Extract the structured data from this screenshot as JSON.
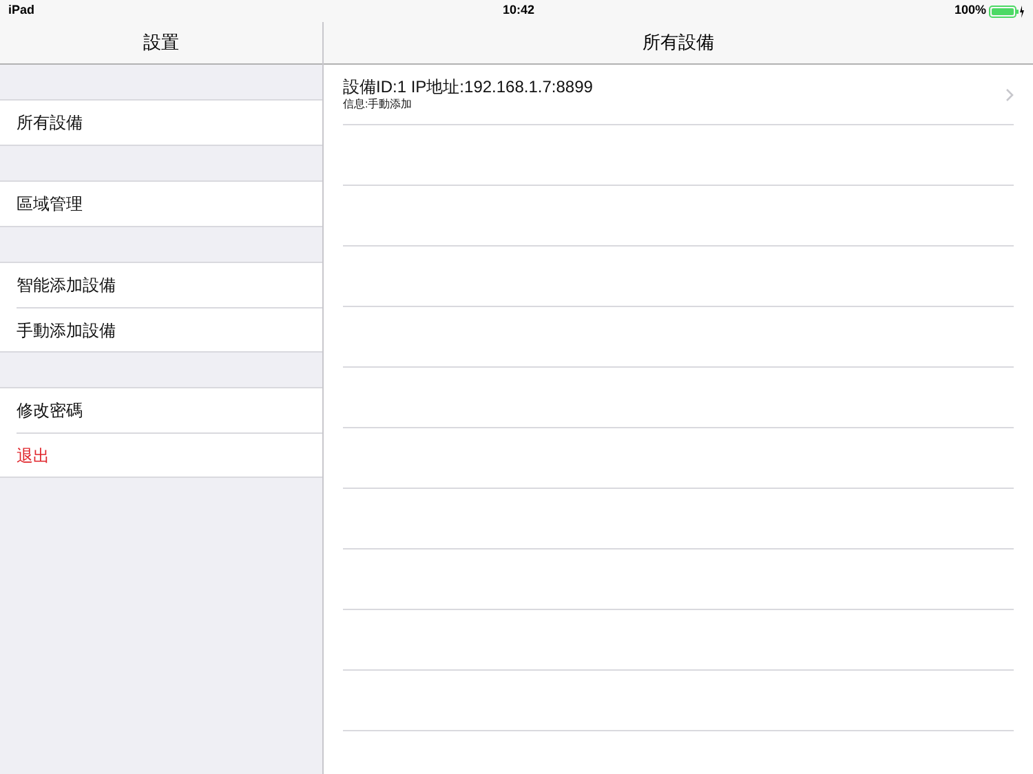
{
  "status_bar": {
    "device": "iPad",
    "time": "10:42",
    "battery": "100%"
  },
  "sidebar": {
    "title": "設置",
    "groups": [
      [
        {
          "label": "所有設備",
          "kind": "normal"
        }
      ],
      [
        {
          "label": "區域管理",
          "kind": "normal"
        }
      ],
      [
        {
          "label": "智能添加設備",
          "kind": "normal"
        },
        {
          "label": "手動添加設備",
          "kind": "normal"
        }
      ],
      [
        {
          "label": "修改密碼",
          "kind": "normal"
        },
        {
          "label": "退出",
          "kind": "destructive"
        }
      ]
    ]
  },
  "detail": {
    "title": "所有設備",
    "devices": [
      {
        "title": "設備ID:1 IP地址:192.168.1.7:8899",
        "subtitle": "信息:手動添加"
      }
    ]
  }
}
